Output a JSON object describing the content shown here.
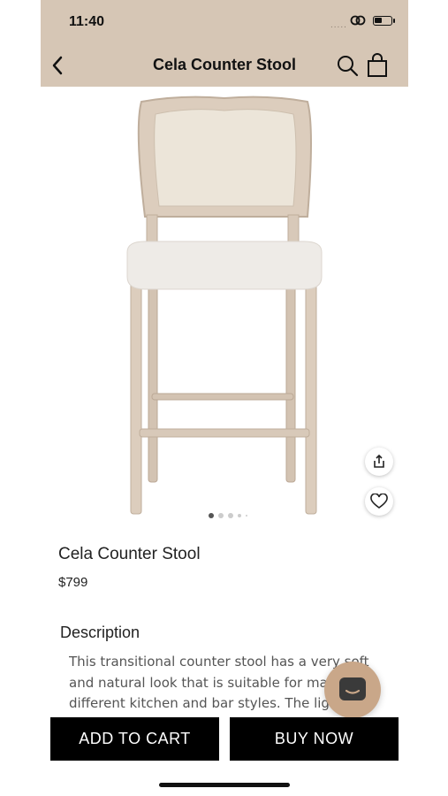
{
  "status": {
    "time": "11:40",
    "signal": "....."
  },
  "header": {
    "title": "Cela Counter Stool"
  },
  "product": {
    "name": "Cela Counter Stool",
    "price": "$799",
    "image_pages": 5,
    "current_page": 1
  },
  "description": {
    "heading": "Description",
    "text": "This transitional counter stool has a very soft and natural look that is suitable for many different kitchen and bar styles. The light"
  },
  "actions": {
    "add_to_cart": "ADD TO CART",
    "buy_now": "BUY NOW"
  },
  "colors": {
    "header_bg": "#d6c6b5",
    "chat_bg": "#c9a789",
    "cta_bg": "#000000"
  }
}
